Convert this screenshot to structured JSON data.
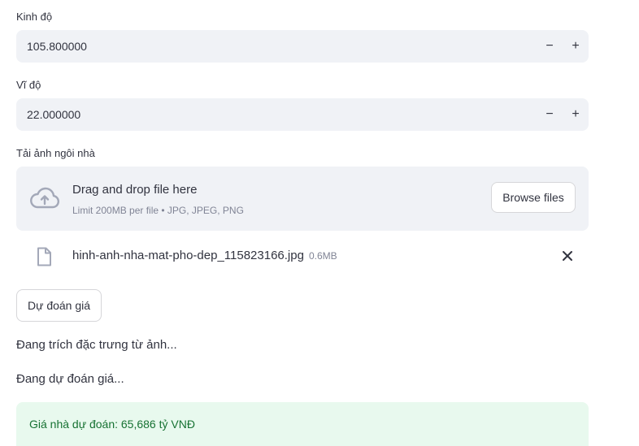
{
  "longitude": {
    "label": "Kinh độ",
    "value": "105.800000",
    "minus": "−",
    "plus": "+"
  },
  "latitude": {
    "label": "Vĩ độ",
    "value": "22.000000",
    "minus": "−",
    "plus": "+"
  },
  "uploader": {
    "label": "Tải ảnh ngôi nhà",
    "title": "Drag and drop file here",
    "subtitle": "Limit 200MB per file • JPG, JPEG, PNG",
    "browse_label": "Browse files",
    "file": {
      "name": "hinh-anh-nha-mat-pho-dep_115823166.jpg",
      "size": "0.6MB"
    }
  },
  "predict_button": "Dự đoán giá",
  "status": {
    "extracting": "Đang trích đặc trưng từ ảnh...",
    "predicting": "Đang dự đoán giá..."
  },
  "result": "Giá nhà dự đoán: 65,686 tỷ VNĐ",
  "colors": {
    "input_bg": "#f0f2f6",
    "success_bg": "#e8f9ee",
    "success_text": "#177233"
  }
}
